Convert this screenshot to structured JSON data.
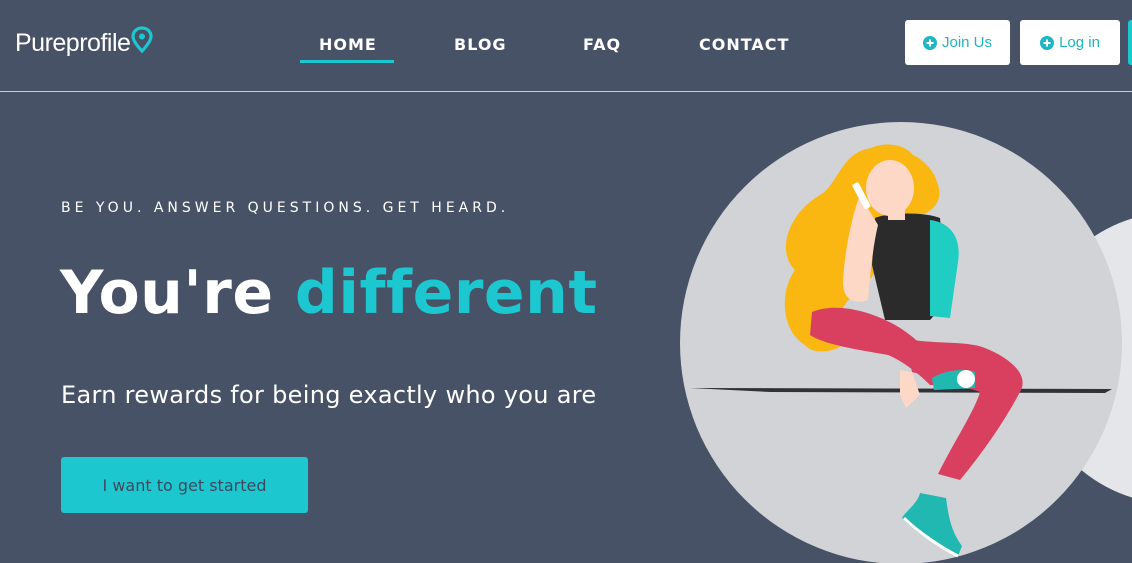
{
  "brand": {
    "name": "Pureprofile",
    "accent": "#1cc7d0",
    "background": "#475266"
  },
  "nav": {
    "items": [
      {
        "label": "HOME",
        "active": true
      },
      {
        "label": "BLOG",
        "active": false
      },
      {
        "label": "FAQ",
        "active": false
      },
      {
        "label": "CONTACT",
        "active": false
      }
    ]
  },
  "header_buttons": {
    "join_label": "Join Us",
    "login_label": "Log in",
    "icon": "plus-circle-icon"
  },
  "hero": {
    "tagline": "BE YOU. ANSWER QUESTIONS. GET HEARD.",
    "headline_plain": "You're",
    "headline_accent": "different",
    "subline": "Earn rewards for being exactly who you are",
    "cta_label": "I want to get started"
  },
  "illustration": {
    "subject": "woman-sitting-on-phone-illustration"
  }
}
